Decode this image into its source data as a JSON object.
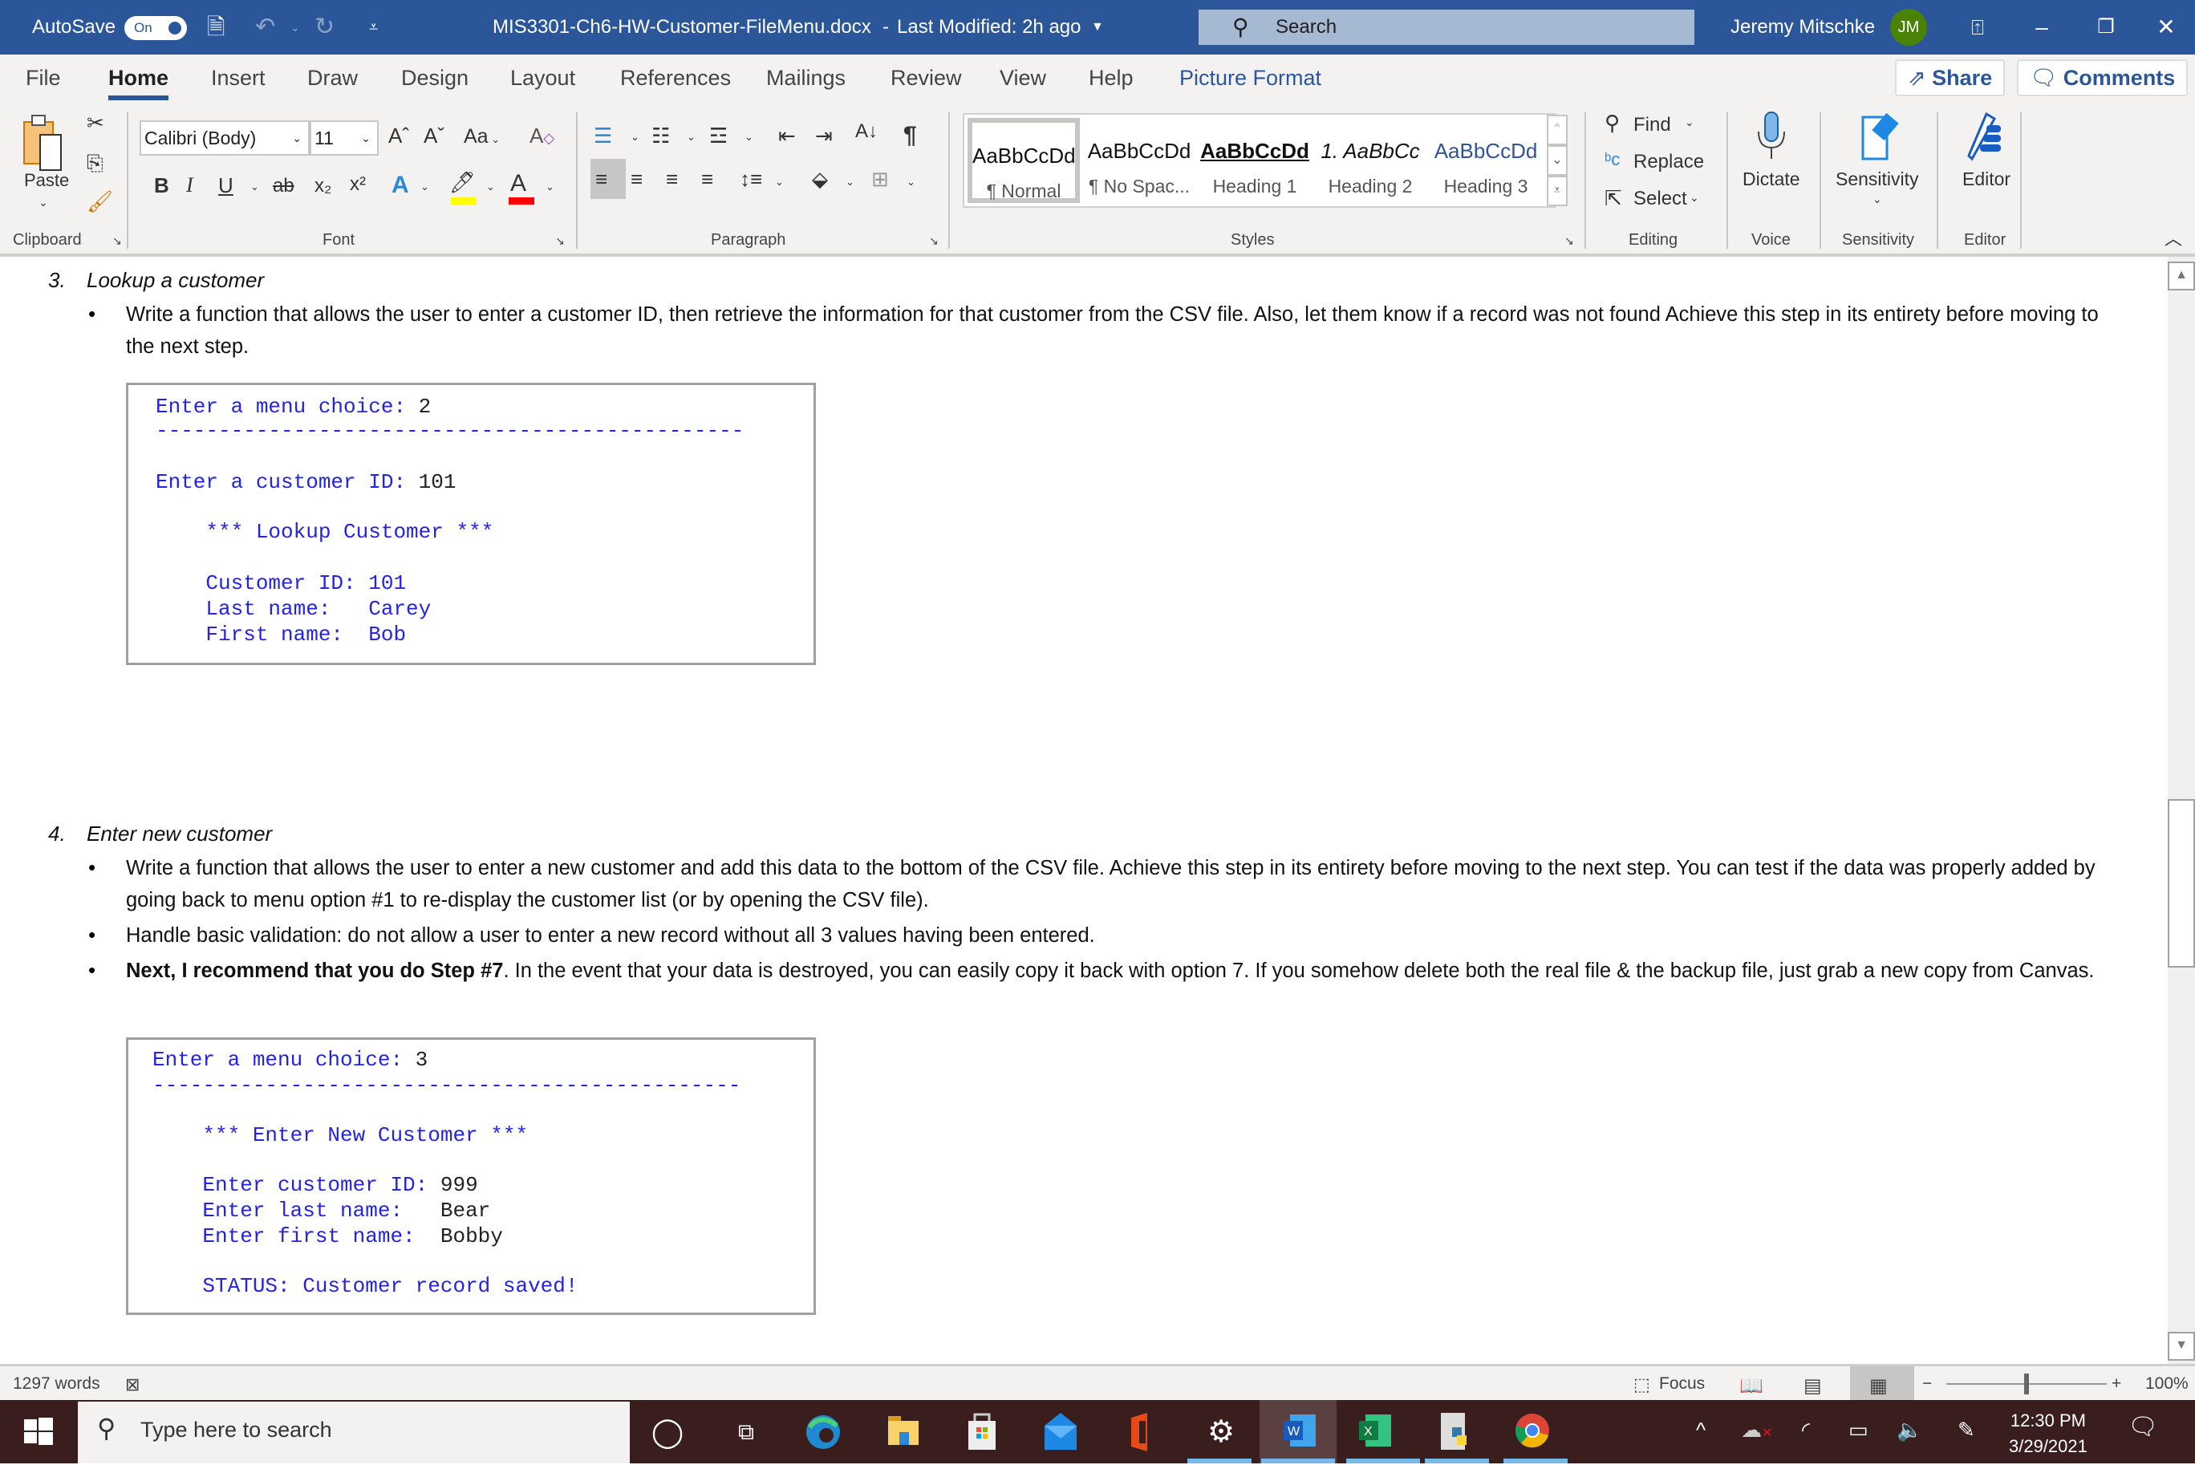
{
  "titlebar": {
    "autosave_label": "AutoSave",
    "autosave_state": "On",
    "document_title": "MIS3301-Ch6-HW-Customer-FileMenu.docx",
    "separator": "-",
    "last_modified": "Last Modified: 2h ago",
    "search_placeholder": "Search",
    "user_name": "Jeremy Mitschke",
    "user_initials": "JM",
    "accent_color": "#2b579a",
    "avatar_color": "#498205"
  },
  "tabs": [
    {
      "label": "File"
    },
    {
      "label": "Home",
      "active": true
    },
    {
      "label": "Insert"
    },
    {
      "label": "Draw"
    },
    {
      "label": "Design"
    },
    {
      "label": "Layout"
    },
    {
      "label": "References"
    },
    {
      "label": "Mailings"
    },
    {
      "label": "Review"
    },
    {
      "label": "View"
    },
    {
      "label": "Help"
    },
    {
      "label": "Picture Format"
    }
  ],
  "top_buttons": {
    "share": "Share",
    "comments": "Comments"
  },
  "ribbon": {
    "clipboard": {
      "paste_label": "Paste",
      "group_label": "Clipboard"
    },
    "font": {
      "font_name": "Calibri (Body)",
      "font_size": "11",
      "case_label": "Aa",
      "bold": "B",
      "italic": "I",
      "underline": "U",
      "strikethrough": "ab",
      "subscript": "x₂",
      "superscript": "x²",
      "group_label": "Font",
      "highlight_color": "#ffff00",
      "font_color": "#ff0000"
    },
    "paragraph": {
      "group_label": "Paragraph"
    },
    "styles": {
      "group_label": "Styles",
      "items": [
        {
          "preview": "AaBbCcDd",
          "name": "¶ Normal",
          "selected": true
        },
        {
          "preview": "AaBbCcDd",
          "name": "¶ No Spac..."
        },
        {
          "preview": "AaBbCcDd",
          "name": "Heading 1"
        },
        {
          "preview": "1.  AaBbCc",
          "name": "Heading 2"
        },
        {
          "preview": "AaBbCcDd",
          "name": "Heading 3"
        }
      ]
    },
    "editing": {
      "find": "Find",
      "replace": "Replace",
      "select": "Select",
      "group_label": "Editing"
    },
    "voice": {
      "dictate": "Dictate",
      "group_label": "Voice"
    },
    "sensitivity": {
      "button": "Sensitivity",
      "group_label": "Sensitivity"
    },
    "editor": {
      "button": "Editor",
      "group_label": "Editor"
    }
  },
  "document": {
    "sections": [
      {
        "number": "3.",
        "title": "Lookup a customer",
        "bullets": [
          {
            "bold": "",
            "text": "Write a function that allows the user to enter a customer ID, then retrieve the information for that customer from the CSV file. Also, let them know if a record was not found Achieve this step in its entirety before moving to the next step."
          }
        ],
        "console": {
          "lines": [
            {
              "prompt": "Enter a menu choice: ",
              "value": "2"
            },
            {
              "dashes": "-----------------------------------------------"
            },
            {
              "prompt": "Enter a customer ID: ",
              "value": "101"
            },
            {
              "prompt": "    *** Lookup Customer ***",
              "value": ""
            },
            {
              "prompt": "    Customer ID: ",
              "value": "101"
            },
            {
              "prompt": "    Last name:   ",
              "value": "Carey"
            },
            {
              "prompt": "    First name:  ",
              "value": "Bob"
            }
          ]
        }
      },
      {
        "number": "4.",
        "title": "Enter new customer",
        "bullets": [
          {
            "bold": "",
            "text": "Write a function that allows the user to enter a new customer and add this data to the bottom of the CSV file. Achieve this step in its entirety before moving to the next step. You can test if the data was properly added by going back to menu option #1 to re-display the customer list (or by opening the CSV file)."
          },
          {
            "bold": "",
            "text": "Handle basic validation: do not allow a user to enter a new record without all 3 values having been entered."
          },
          {
            "bold": "Next, I recommend that you do Step #7",
            "text": ". In the event that your data is destroyed, you can easily copy it back with option 7. If you somehow delete both the real file & the backup file, just grab a new copy from Canvas."
          }
        ],
        "console": {
          "lines": [
            {
              "prompt": "Enter a menu choice: ",
              "value": "3"
            },
            {
              "dashes": "-----------------------------------------------"
            },
            {
              "prompt": "    *** Enter New Customer ***",
              "value": ""
            },
            {
              "prompt": "    Enter customer ID: ",
              "value": "999"
            },
            {
              "prompt": "    Enter last name:   ",
              "value": "Bear"
            },
            {
              "prompt": "    Enter first name:  ",
              "value": "Bobby"
            },
            {
              "prompt": "    STATUS: Customer record saved!",
              "value": ""
            }
          ]
        }
      }
    ],
    "console_prompt_color": "#2323e6"
  },
  "statusbar": {
    "word_count": "1297 words",
    "focus": "Focus",
    "zoom_level": "100%",
    "zoom_minus": "−",
    "zoom_plus": "+",
    "zoom_fraction": 0.5
  },
  "taskbar": {
    "search_placeholder": "Type here to search",
    "time": "12:30 PM",
    "date": "3/29/2021",
    "apps": [
      {
        "name": "cortana"
      },
      {
        "name": "task-view"
      },
      {
        "name": "edge"
      },
      {
        "name": "file-explorer"
      },
      {
        "name": "microsoft-store"
      },
      {
        "name": "mail"
      },
      {
        "name": "office"
      },
      {
        "name": "settings"
      },
      {
        "name": "word",
        "active": true
      },
      {
        "name": "excel"
      },
      {
        "name": "python"
      },
      {
        "name": "chrome"
      }
    ]
  }
}
